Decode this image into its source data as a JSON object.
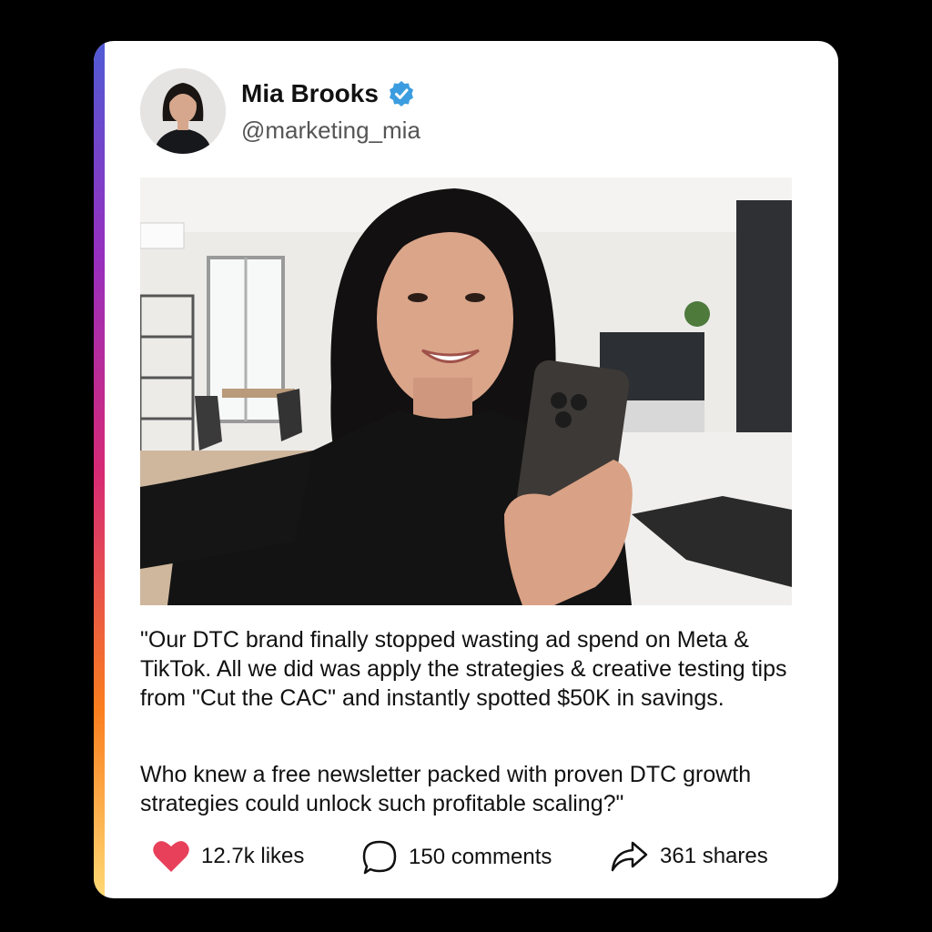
{
  "post": {
    "author": {
      "name": "Mia Brooks",
      "handle": "@marketing_mia",
      "verified": true,
      "verified_color": "#3b9ddf"
    },
    "body": {
      "paragraph_1": "\"Our DTC brand finally stopped wasting ad spend on Meta & TikTok. All we did was apply the strategies & creative testing tips from \"Cut the CAC\" and instantly spotted $50K in savings.",
      "paragraph_2": "Who knew a free newsletter packed with proven DTC growth strategies could unlock such profitable scaling?\""
    },
    "image": {
      "icon": "smiling-woman-selfie-photo"
    },
    "actions": {
      "likes": "12.7k likes",
      "comments": "150 comments",
      "shares": "361 shares",
      "like_color": "#e8405a"
    }
  }
}
